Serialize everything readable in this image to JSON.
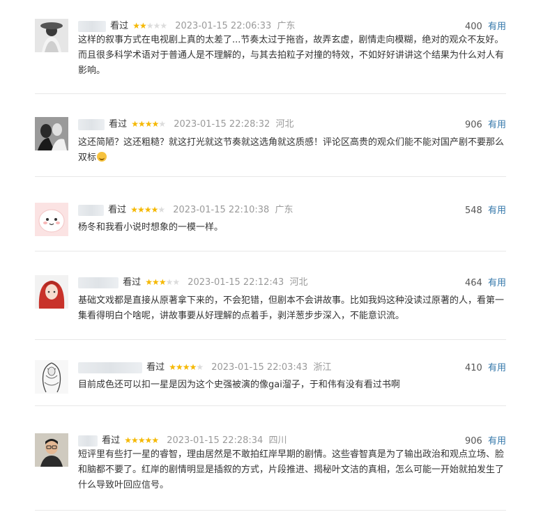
{
  "comments": [
    {
      "watched": "看过",
      "stars": "★★",
      "stars_off": "★★★",
      "time": "2023-01-15 22:06:33",
      "location": "广东",
      "votes": "400",
      "useful": "有用",
      "content": "这样的叙事方式在电视剧上真的太差了...节奏太过于拖沓，故弄玄虚，剧情走向模糊，绝对的观众不友好。而且很多科学术语对于普通人是不理解的，与其去拍粒子对撞的特效，不如好好讲讲这个结果为什么对人有影响。"
    },
    {
      "watched": "看过",
      "stars": "★★★★",
      "stars_off": "★",
      "time": "2023-01-15 22:28:32",
      "location": "河北",
      "votes": "906",
      "useful": "有用",
      "content": "这还简陋？这还粗糙？就这打光就这节奏就这选角就这质感！评论区高贵的观众们能不能对国产剧不要那么双标"
    },
    {
      "watched": "看过",
      "stars": "★★★★",
      "stars_off": "★",
      "time": "2023-01-15 22:10:38",
      "location": "广东",
      "votes": "548",
      "useful": "有用",
      "content": "杨冬和我看小说时想象的一模一样。"
    },
    {
      "watched": "看过",
      "stars": "★★★",
      "stars_off": "★★",
      "time": "2023-01-15 22:12:43",
      "location": "河北",
      "votes": "464",
      "useful": "有用",
      "content": "基础文戏都是直接从原著拿下来的，不会犯错，但剧本不会讲故事。比如我妈这种没读过原著的人，看第一集看得明白个啥呢，讲故事要从好理解的点着手，剥洋葱步步深入，不能意识流。"
    },
    {
      "watched": "看过",
      "stars": "★★★★",
      "stars_off": "★",
      "time": "2023-01-15 22:03:43",
      "location": "浙江",
      "votes": "410",
      "useful": "有用",
      "content": "目前成色还可以扣一星是因为这个史强被演的像gai溜子，于和伟有没有看过书啊"
    },
    {
      "watched": "看过",
      "stars": "★★★★★",
      "stars_off": "",
      "time": "2023-01-15 22:28:34",
      "location": "四川",
      "votes": "906",
      "useful": "有用",
      "content": "短评里有些打一星的睿智，理由居然是不敢拍红岸早期的剧情。这些睿智真是为了输出政治和观点立场、脸和脑都不要了。红岸的剧情明显是插叙的方式，片段推进、揭秘叶文洁的真相，怎么可能一开始就拍发生了什么导致叶回应信号。"
    }
  ]
}
